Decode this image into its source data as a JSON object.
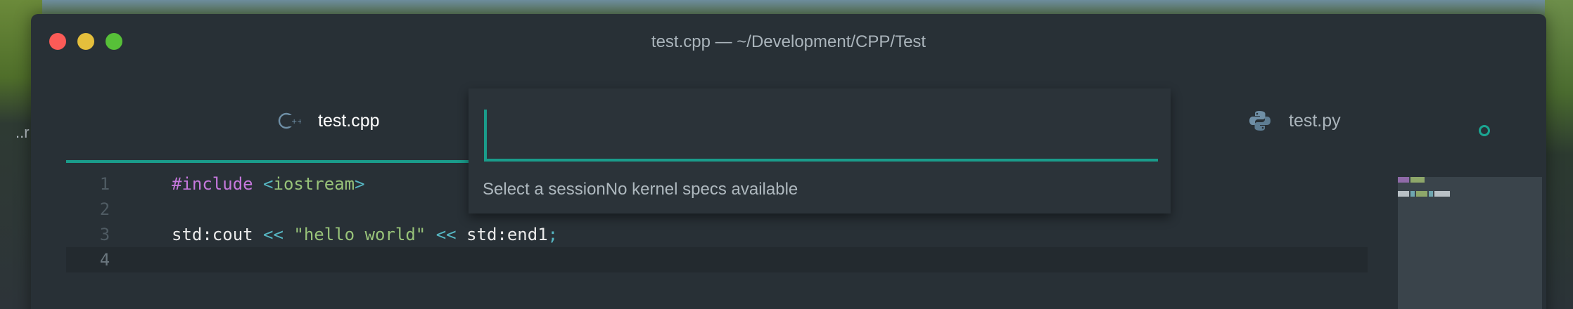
{
  "window": {
    "title": "test.cpp — ~/Development/CPP/Test"
  },
  "background": {
    "behind_text": "..r"
  },
  "tabs": [
    {
      "label": "test.cpp",
      "icon": "cpp-icon",
      "active": true
    },
    {
      "label": "test.py",
      "icon": "python-icon",
      "active": false,
      "modified": true
    }
  ],
  "editor": {
    "line_numbers": [
      "1",
      "2",
      "3",
      "4"
    ],
    "lines": [
      [
        {
          "t": "#include",
          "c": "kw"
        },
        {
          "t": " ",
          "c": "plain"
        },
        {
          "t": "<",
          "c": "op"
        },
        {
          "t": "iostream",
          "c": "inc"
        },
        {
          "t": ">",
          "c": "op"
        }
      ],
      [],
      [
        {
          "t": "std:cout",
          "c": "plain"
        },
        {
          "t": " ",
          "c": "plain"
        },
        {
          "t": "<<",
          "c": "op"
        },
        {
          "t": " ",
          "c": "plain"
        },
        {
          "t": "\"hello world\"",
          "c": "str"
        },
        {
          "t": " ",
          "c": "plain"
        },
        {
          "t": "<<",
          "c": "op"
        },
        {
          "t": " ",
          "c": "plain"
        },
        {
          "t": "std:end1",
          "c": "plain"
        },
        {
          "t": ";",
          "c": "op"
        }
      ],
      []
    ],
    "current_line": "4"
  },
  "session_picker": {
    "input_value": "",
    "message": "Select a sessionNo kernel specs available"
  },
  "colors": {
    "accent": "#1a9c8b",
    "keyword": "#c678dd",
    "operator": "#56b6c2",
    "string": "#98c379"
  }
}
